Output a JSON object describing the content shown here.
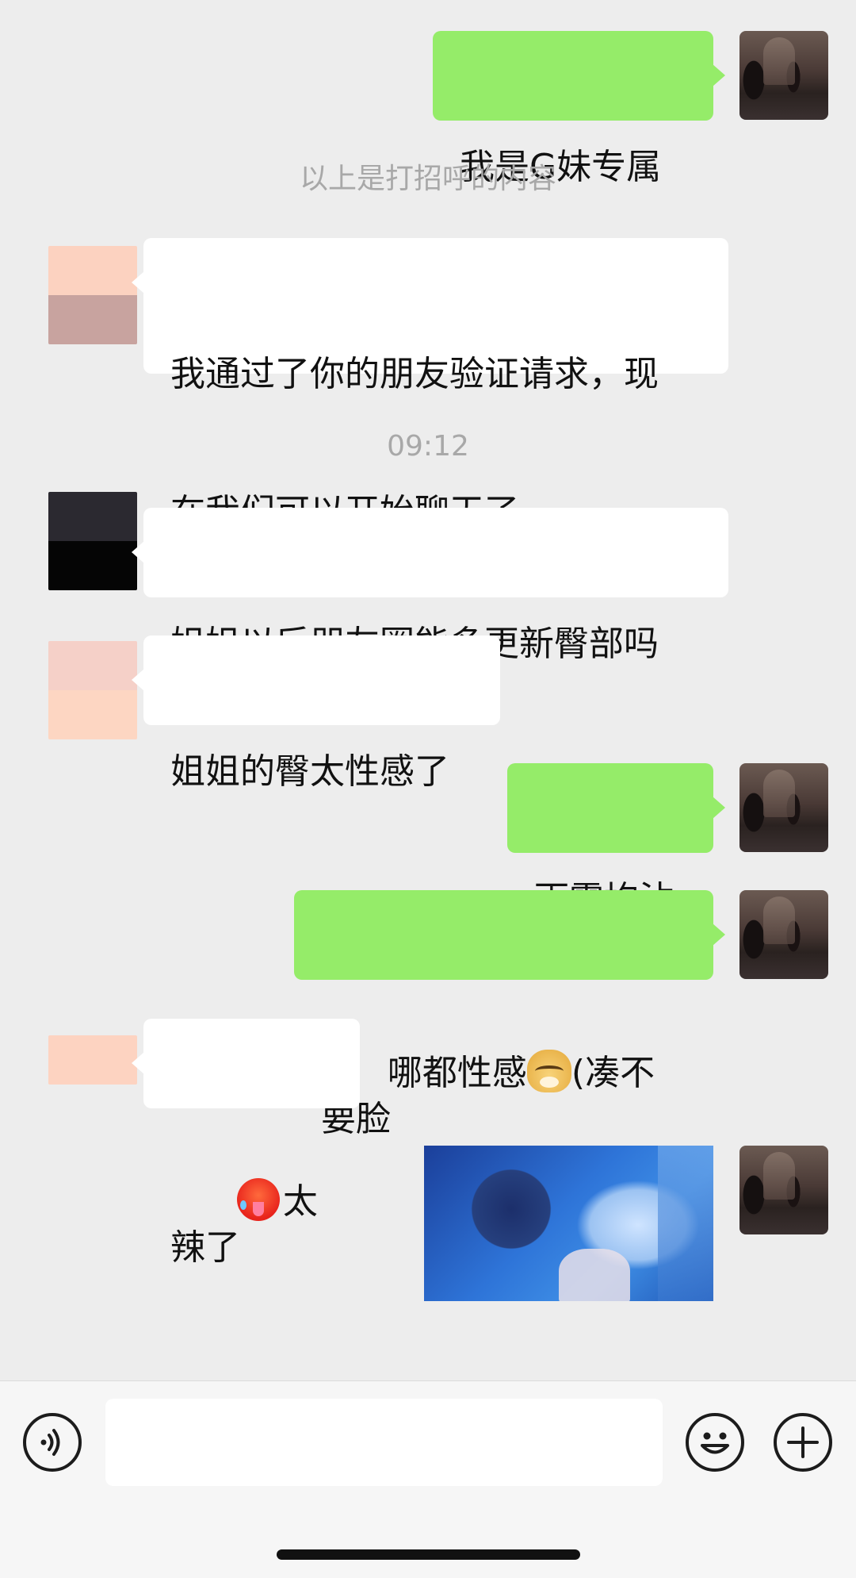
{
  "messages": {
    "m1": "我是G妹专属",
    "sys1": "以上是打招呼的内容",
    "m2_line1": "我通过了你的朋友验证请求，现",
    "m2_line2": "在我们可以开始聊天了",
    "time1": "09:12",
    "m3": "姐姐以后朋友圈能多更新臀部吗",
    "m4": "姐姐的臀太性感了",
    "m5": "雨露均沾",
    "m6_a": "哪都性感",
    "m6_b": "(凑不要脸",
    "m7": "太辣了"
  },
  "emoji": {
    "m6_inline": "doge-emoji",
    "m7_inline": "hot-face-emoji"
  },
  "avatars": {
    "them_1": [
      "#fcd2c0",
      "#c8a39f"
    ],
    "them_2": [
      "#2b2930",
      "#050505"
    ],
    "them_3": [
      "#f5d0c8",
      "#fdd6c2"
    ],
    "them_4": [
      "#fdd3c1"
    ]
  },
  "composer": {
    "voice_icon": "voice-icon",
    "emoji_icon": "emoji-icon",
    "plus_icon": "plus-icon",
    "input_value": ""
  },
  "colors": {
    "background": "#ededed",
    "sent_bubble": "#95ec69",
    "received_bubble": "#ffffff",
    "system_text": "#a8a8a8"
  }
}
